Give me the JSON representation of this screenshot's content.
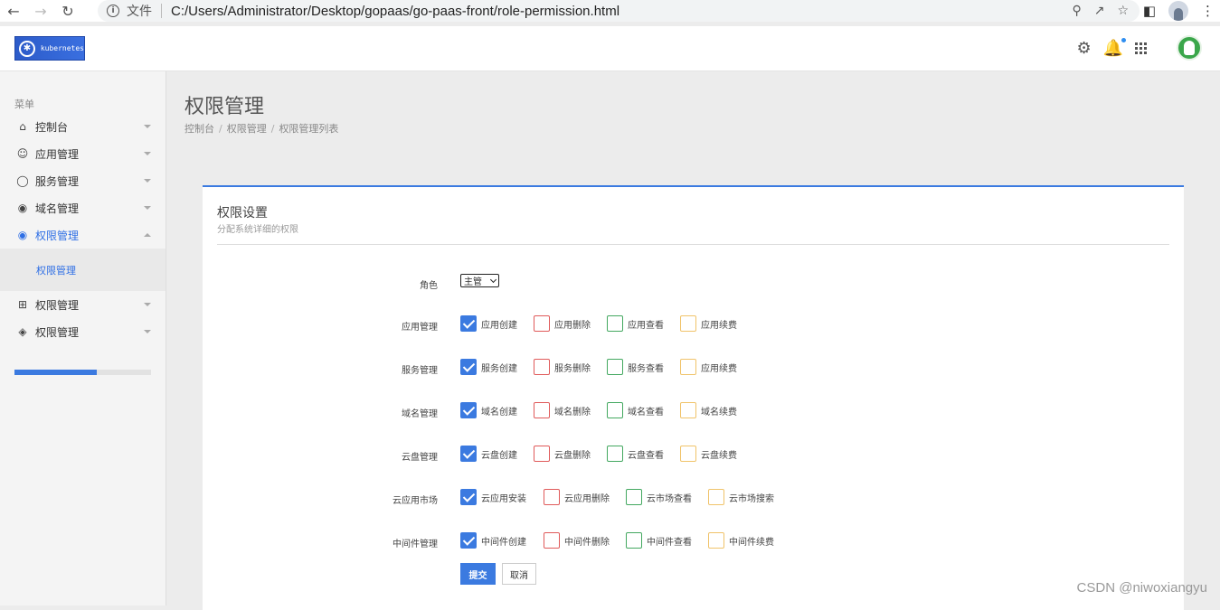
{
  "browser": {
    "scheme_label": "文件",
    "url": "C:/Users/Administrator/Desktop/gopaas/go-paas-front/role-permission.html"
  },
  "header": {
    "logo_text": "kubernetes"
  },
  "sidebar": {
    "menu_heading": "菜单",
    "items": [
      {
        "label": "控制台",
        "icon": "home-icon"
      },
      {
        "label": "应用管理",
        "icon": "smile-icon"
      },
      {
        "label": "服务管理",
        "icon": "circle-icon"
      },
      {
        "label": "域名管理",
        "icon": "target-icon"
      },
      {
        "label": "权限管理",
        "icon": "radio-icon",
        "active": true
      },
      {
        "label": "权限管理",
        "icon": "table-icon"
      },
      {
        "label": "权限管理",
        "icon": "layers-icon"
      }
    ],
    "submenu_item": "权限管理",
    "progress_fraction": 0.6
  },
  "page": {
    "title": "权限管理",
    "breadcrumb": [
      "控制台",
      "权限管理",
      "权限管理列表"
    ]
  },
  "panel": {
    "title": "权限设置",
    "subtitle": "分配系统详细的权限",
    "role_label": "角色",
    "role_value": "主管",
    "rows": [
      {
        "label": "应用管理",
        "options": [
          "应用创建",
          "应用删除",
          "应用查看",
          "应用续费"
        ]
      },
      {
        "label": "服务管理",
        "options": [
          "服务创建",
          "服务删除",
          "服务查看",
          "应用续费"
        ]
      },
      {
        "label": "域名管理",
        "options": [
          "域名创建",
          "域名删除",
          "域名查看",
          "域名续费"
        ]
      },
      {
        "label": "云盘管理",
        "options": [
          "云盘创建",
          "云盘删除",
          "云盘查看",
          "云盘续费"
        ]
      },
      {
        "label": "云应用市场",
        "options": [
          "云应用安装",
          "云应用删除",
          "云市场查看",
          "云市场搜索"
        ]
      },
      {
        "label": "中间件管理",
        "options": [
          "中间件创建",
          "中间件删除",
          "中间件查看",
          "中间件续费"
        ]
      }
    ],
    "submit_label": "提交",
    "cancel_label": "取消"
  },
  "colors": {
    "accent": "#3b7ae0",
    "delete": "#e05a5a",
    "view": "#43a860",
    "renew": "#f0c36a"
  },
  "watermark": "CSDN @niwoxiangyu"
}
